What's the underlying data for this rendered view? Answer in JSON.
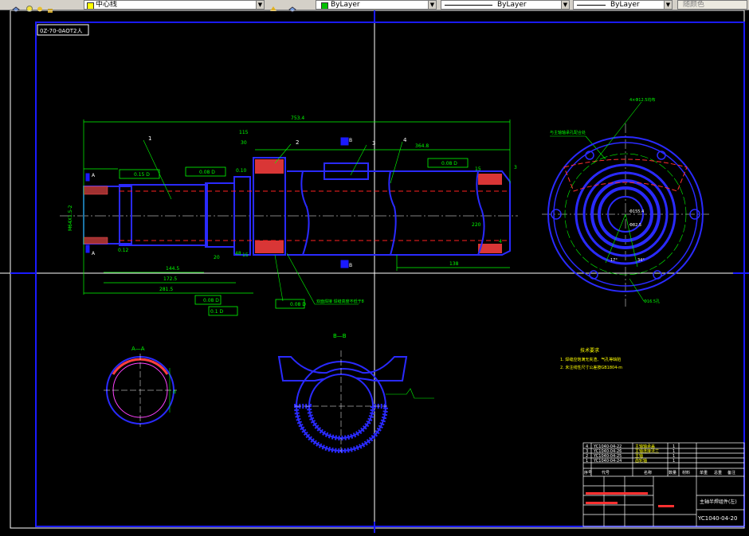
{
  "toolbar": {
    "layer_name": "中心线",
    "color_value": "ByLayer",
    "linetype_value": "ByLayer",
    "lineweight_value": "ByLayer",
    "plotstyle_value": "随颜色"
  },
  "drawing": {
    "drawing_code": "0Z-70-0AOT2人",
    "dims": {
      "overall_length": "753.4",
      "dim_364": "364.8",
      "dim_144": "144.5",
      "dim_172": "172.5",
      "dim_281": "281.5",
      "dim_138": "138",
      "dim_220": "220",
      "dim_010": "0.10",
      "dim_012": "0.12",
      "dim_015": "15",
      "dim_115": "115",
      "dim_30": "30",
      "dim_15_small": "15",
      "dim_thread": "M64X1.5-2",
      "dim_48": "48",
      "dim_20": "20",
      "dim_3": "3",
      "dim_4": "4"
    },
    "tolerances": {
      "t1": "0.15 D",
      "t2": "0.08 D",
      "t3": "0.08 D",
      "t4": "0.08 D",
      "t5": "0.1 D",
      "t6": "0.08 D"
    },
    "balloons": [
      "1",
      "2",
      "3",
      "4"
    ],
    "section_a_label": "A",
    "section_b_label": "B",
    "section_aa_title": "A—A",
    "section_bb_title": "B—B",
    "section_aa_dim": "d",
    "end_view_note": "4×Φ12.5均布",
    "end_view_dim_inner": "Φ155.4",
    "end_view_dim_hole": "Φ82.5",
    "end_view_angle_a": "17°",
    "end_view_angle_b": "34°",
    "end_view_dim_bottom": "Φ16.5孔",
    "weld_note_top": "与主轴轴承孔配合处",
    "weld_note_bottom": "双面焊接 焊缝高度不低于8",
    "tech_title": "技术要求",
    "tech_req_1": "1.  焊缝应饱满无夹渣、气孔等缺陷",
    "tech_req_2": "2.  未注线性尺寸公差按GB1804-m"
  },
  "title_block": {
    "parts": [
      {
        "no": "4",
        "code": "YC1040-04-22",
        "name": "主轴轴承盖",
        "qty": "1"
      },
      {
        "no": "3",
        "code": "YC1040-04-26",
        "name": "主轴连接法兰",
        "qty": "1"
      },
      {
        "no": "2",
        "code": "YC1040-04-25",
        "name": "主轴",
        "qty": "1"
      },
      {
        "no": "1",
        "code": "YC1040-04-24",
        "name": "齿轮轴",
        "qty": "1"
      }
    ],
    "header_cells": [
      "序号",
      "代号",
      "名称",
      "数量",
      "材料",
      "单重",
      "总重",
      "备注"
    ],
    "product_name": "主轴半焊组件(左)",
    "drawing_number": "YC1040-04-20"
  }
}
